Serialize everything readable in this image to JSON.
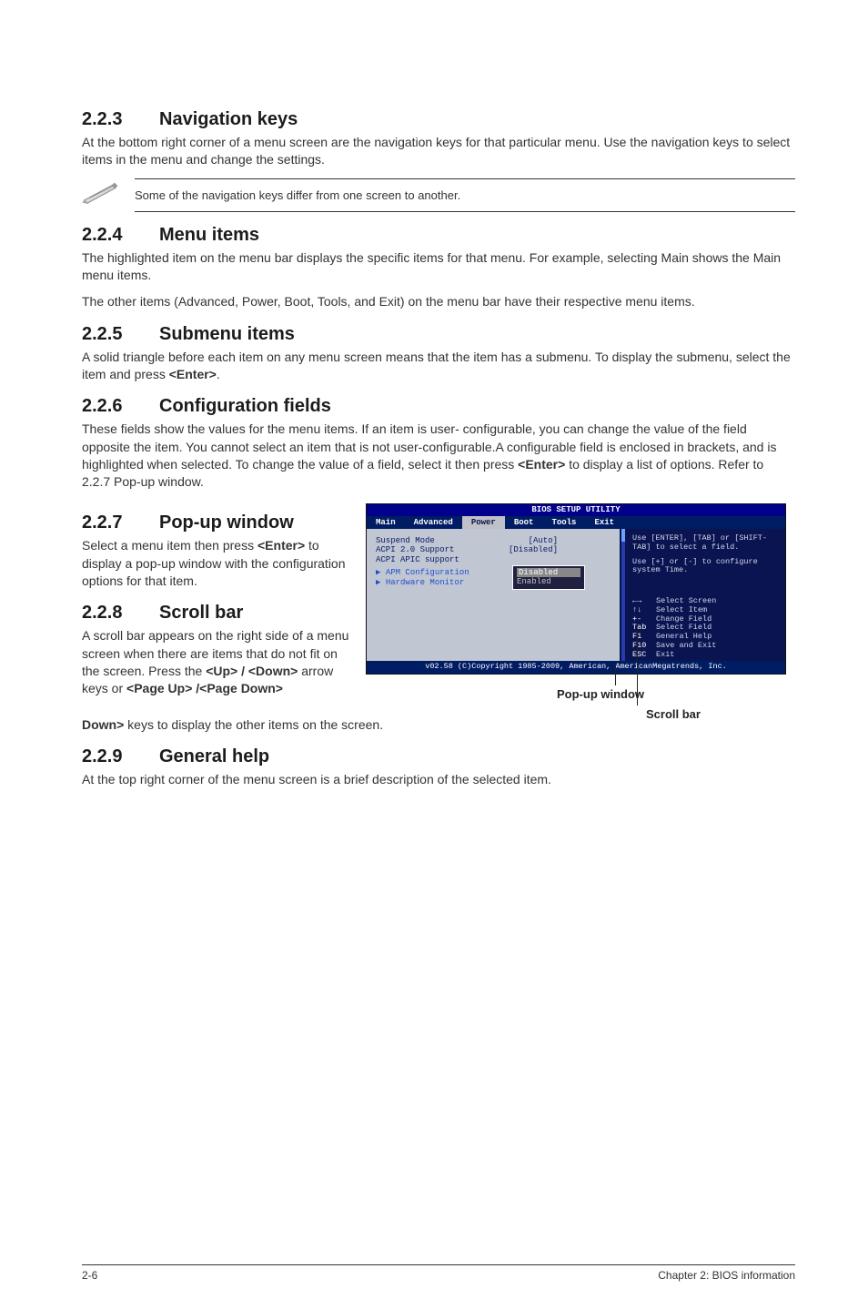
{
  "sections": {
    "s223": {
      "num": "2.2.3",
      "title": "Navigation keys",
      "p1": "At the bottom right corner of a menu screen are the navigation keys for that particular menu. Use the navigation keys to select items in the menu and change the settings."
    },
    "note": "Some of the navigation keys differ from one screen to another.",
    "s224": {
      "num": "2.2.4",
      "title": "Menu items",
      "p1": "The highlighted item on the menu bar displays the specific items for that menu. For example, selecting Main shows the Main menu items.",
      "p2": "The other items (Advanced, Power, Boot, Tools, and Exit) on the menu bar have their respective menu items."
    },
    "s225": {
      "num": "2.2.5",
      "title": "Submenu items",
      "p1": "A solid triangle before each item on any menu screen means that the item has a submenu. To display the submenu, select the item and press "
    },
    "s225_k": "<Enter>",
    "s225_k_after": ".",
    "s226": {
      "num": "2.2.6",
      "title": "Configuration fields",
      "p1a": "These fields show the values for the menu items. If an item is user- configurable, you can change the value of the field opposite the item. You cannot select an item that is not user-configurable.A configurable field is enclosed in brackets, and is highlighted when selected. To change the value of a field, select it then press ",
      "p1b": "<Enter>",
      "p1c": " to display a list of options. Refer to 2.2.7 Pop-up window."
    },
    "s227": {
      "num": "2.2.7",
      "title": "Pop-up window",
      "p1a": "Select a menu item then press ",
      "p1b": "<Enter>",
      "p1c": " to display a pop-up window with the configuration options for that item."
    },
    "s228": {
      "num": "2.2.8",
      "title": "Scroll bar",
      "p1a": "A scroll bar appears on the right side of a menu screen when there are items that do not fit on the screen. Press the ",
      "p1b": "<Up> / <Down>",
      "p1c": " arrow keys or ",
      "p1d": "<Page Up> /<Page Down>",
      "p1e": " keys to display the other items on the screen."
    },
    "s229": {
      "num": "2.2.9",
      "title": "General help",
      "p1": "At the top right corner of the menu screen is a brief description of the selected item."
    }
  },
  "bios": {
    "title": "BIOS SETUP UTILITY",
    "tabs": [
      "Main",
      "Advanced",
      "Power",
      "Boot",
      "Tools",
      "Exit"
    ],
    "active_tab": "Power",
    "rows": [
      {
        "label": "Suspend Mode",
        "val": "[Auto]"
      },
      {
        "label": "ACPI 2.0 Support",
        "val": "[Disabled]"
      },
      {
        "label": "ACPI APIC support",
        "val": ""
      }
    ],
    "popup": {
      "sel": "Disabled",
      "other": "Enabled"
    },
    "subs": [
      "APM Configuration",
      "Hardware Monitor"
    ],
    "help1": "Use [ENTER], [TAB] or [SHIFT-TAB] to select a field.",
    "help2": "Use [+] or [-] to configure system Time.",
    "keys": [
      {
        "k": "←→",
        "d": "Select Screen"
      },
      {
        "k": "↑↓",
        "d": "Select Item"
      },
      {
        "k": "+-",
        "d": "Change Field"
      },
      {
        "k": "Tab",
        "d": "Select Field"
      },
      {
        "k": "F1",
        "d": "General Help"
      },
      {
        "k": "F10",
        "d": "Save and Exit"
      },
      {
        "k": "ESC",
        "d": "Exit"
      }
    ],
    "footer": "v02.58 (C)Copyright 1985-2009, American, AmericanMegatrends, Inc."
  },
  "callouts": {
    "popup": "Pop-up window",
    "scroll": "Scroll bar"
  },
  "footer": {
    "left": "2-6",
    "right": "Chapter 2: BIOS information"
  }
}
